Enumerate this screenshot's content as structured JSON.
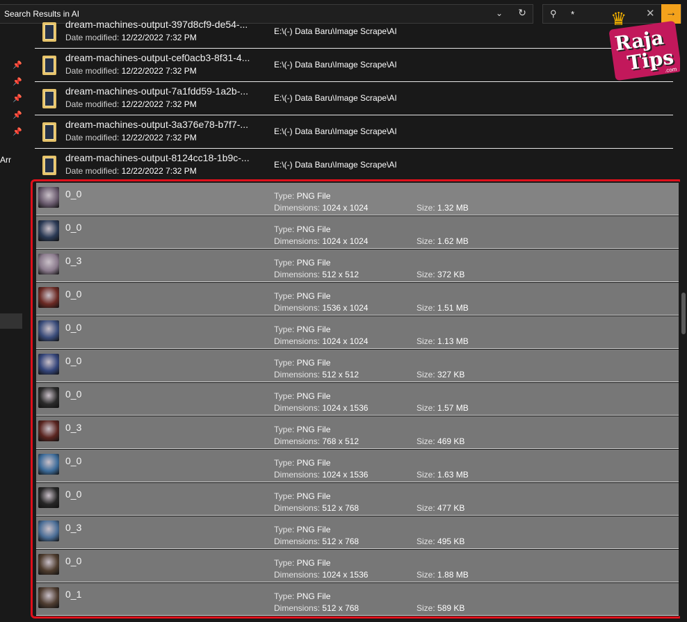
{
  "address": {
    "title": "Search Results in AI"
  },
  "search": {
    "value": "*"
  },
  "logo": {
    "line1": "Raja",
    "line2": "Tips",
    "suffix": ".com"
  },
  "nav": {
    "label": "Arr"
  },
  "folders": [
    {
      "name": "dream-machines-output-397d8cf9-de54-...",
      "date_label": "Date modified:",
      "date": "12/22/2022 7:32 PM",
      "path": "E:\\(-) Data Baru\\Image Scrape\\AI"
    },
    {
      "name": "dream-machines-output-cef0acb3-8f31-4...",
      "date_label": "Date modified:",
      "date": "12/22/2022 7:32 PM",
      "path": "E:\\(-) Data Baru\\Image Scrape\\AI"
    },
    {
      "name": "dream-machines-output-7a1fdd59-1a2b-...",
      "date_label": "Date modified:",
      "date": "12/22/2022 7:32 PM",
      "path": "E:\\(-) Data Baru\\Image Scrape\\AI"
    },
    {
      "name": "dream-machines-output-3a376e78-b7f7-...",
      "date_label": "Date modified:",
      "date": "12/22/2022 7:32 PM",
      "path": "E:\\(-) Data Baru\\Image Scrape\\AI"
    },
    {
      "name": "dream-machines-output-8124cc18-1b9c-...",
      "date_label": "Date modified:",
      "date": "12/22/2022 7:32 PM",
      "path": "E:\\(-) Data Baru\\Image Scrape\\AI"
    }
  ],
  "files": [
    {
      "name": "0_0",
      "type_label": "Type:",
      "type": "PNG File",
      "dim_label": "Dimensions:",
      "dimensions": "1024 x 1024",
      "size_label": "Size:",
      "size": "1.32 MB",
      "thumb_color": "#6a5b6e"
    },
    {
      "name": "0_0",
      "type_label": "Type:",
      "type": "PNG File",
      "dim_label": "Dimensions:",
      "dimensions": "1024 x 1024",
      "size_label": "Size:",
      "size": "1.62 MB",
      "thumb_color": "#2b3a55"
    },
    {
      "name": "0_3",
      "type_label": "Type:",
      "type": "PNG File",
      "dim_label": "Dimensions:",
      "dimensions": "512 x 512",
      "size_label": "Size:",
      "size": "372 KB",
      "thumb_color": "#8a7a8c"
    },
    {
      "name": "0_0",
      "type_label": "Type:",
      "type": "PNG File",
      "dim_label": "Dimensions:",
      "dimensions": "1536 x 1024",
      "size_label": "Size:",
      "size": "1.51 MB",
      "thumb_color": "#6b2a24"
    },
    {
      "name": "0_0",
      "type_label": "Type:",
      "type": "PNG File",
      "dim_label": "Dimensions:",
      "dimensions": "1024 x 1024",
      "size_label": "Size:",
      "size": "1.13 MB",
      "thumb_color": "#3a4c7a"
    },
    {
      "name": "0_0",
      "type_label": "Type:",
      "type": "PNG File",
      "dim_label": "Dimensions:",
      "dimensions": "512 x 512",
      "size_label": "Size:",
      "size": "327 KB",
      "thumb_color": "#34457a"
    },
    {
      "name": "0_0",
      "type_label": "Type:",
      "type": "PNG File",
      "dim_label": "Dimensions:",
      "dimensions": "1024 x 1536",
      "size_label": "Size:",
      "size": "1.57 MB",
      "thumb_color": "#2a2a2a"
    },
    {
      "name": "0_3",
      "type_label": "Type:",
      "type": "PNG File",
      "dim_label": "Dimensions:",
      "dimensions": "768 x 512",
      "size_label": "Size:",
      "size": "469 KB",
      "thumb_color": "#5a2520"
    },
    {
      "name": "0_0",
      "type_label": "Type:",
      "type": "PNG File",
      "dim_label": "Dimensions:",
      "dimensions": "1024 x 1536",
      "size_label": "Size:",
      "size": "1.63 MB",
      "thumb_color": "#3d6c9a"
    },
    {
      "name": "0_0",
      "type_label": "Type:",
      "type": "PNG File",
      "dim_label": "Dimensions:",
      "dimensions": "512 x 768",
      "size_label": "Size:",
      "size": "477 KB",
      "thumb_color": "#262626"
    },
    {
      "name": "0_3",
      "type_label": "Type:",
      "type": "PNG File",
      "dim_label": "Dimensions:",
      "dimensions": "512 x 768",
      "size_label": "Size:",
      "size": "495 KB",
      "thumb_color": "#4a6d96"
    },
    {
      "name": "0_0",
      "type_label": "Type:",
      "type": "PNG File",
      "dim_label": "Dimensions:",
      "dimensions": "1024 x 1536",
      "size_label": "Size:",
      "size": "1.88 MB",
      "thumb_color": "#4e3c2e"
    },
    {
      "name": "0_1",
      "type_label": "Type:",
      "type": "PNG File",
      "dim_label": "Dimensions:",
      "dimensions": "512 x 768",
      "size_label": "Size:",
      "size": "589 KB",
      "thumb_color": "#4f3d31"
    }
  ],
  "colors": {
    "highlight": "#e0101b",
    "search_go": "#f4a21c"
  }
}
